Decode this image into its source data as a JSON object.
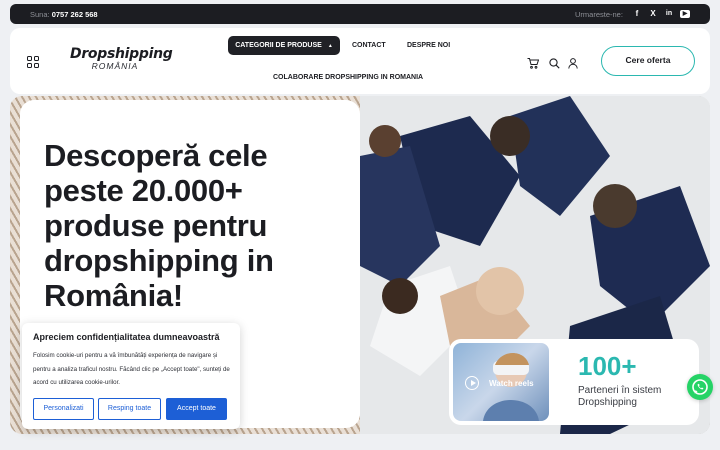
{
  "topbar": {
    "phone_label": "Suna:",
    "phone": "0757 262 568",
    "follow_label": "Urmareste-ne:"
  },
  "social": [
    {
      "name": "facebook-icon",
      "glyph": "f"
    },
    {
      "name": "x-icon",
      "glyph": "X"
    },
    {
      "name": "linkedin-icon",
      "glyph": "in"
    },
    {
      "name": "youtube-icon",
      "glyph": "▶"
    }
  ],
  "header": {
    "logo_main": "Dropshipping",
    "logo_sub": "ROMÂNIA",
    "nav": {
      "categories": "CATEGORII DE PRODUSE",
      "contact": "CONTACT",
      "about": "DESPRE NOI",
      "partnership": "COLABORARE DROPSHIPPING IN ROMANIA"
    },
    "cta": "Cere oferta"
  },
  "hero": {
    "title": "Descoperă cele peste 20.000+ produse pentru dropshipping in România!"
  },
  "cookie": {
    "title": "Apreciem confidențialitatea dumneavoastră",
    "text": "Folosim cookie-uri pentru a vă îmbunătăți experiența de navigare și pentru a analiza traficul nostru. Făcând clic pe „Accept toate\", sunteți de acord cu utilizarea cookie-urilor.",
    "customize": "Personalizati",
    "reject": "Resping toate",
    "accept": "Accept toate"
  },
  "stats": {
    "reels_label": "Watch reels",
    "number": "100+",
    "label": "Parteneri în sistem Dropshipping"
  },
  "colors": {
    "accent": "#2bb8b0",
    "dark": "#1c1d22",
    "blue": "#1d5fd6",
    "whatsapp": "#25d366"
  }
}
